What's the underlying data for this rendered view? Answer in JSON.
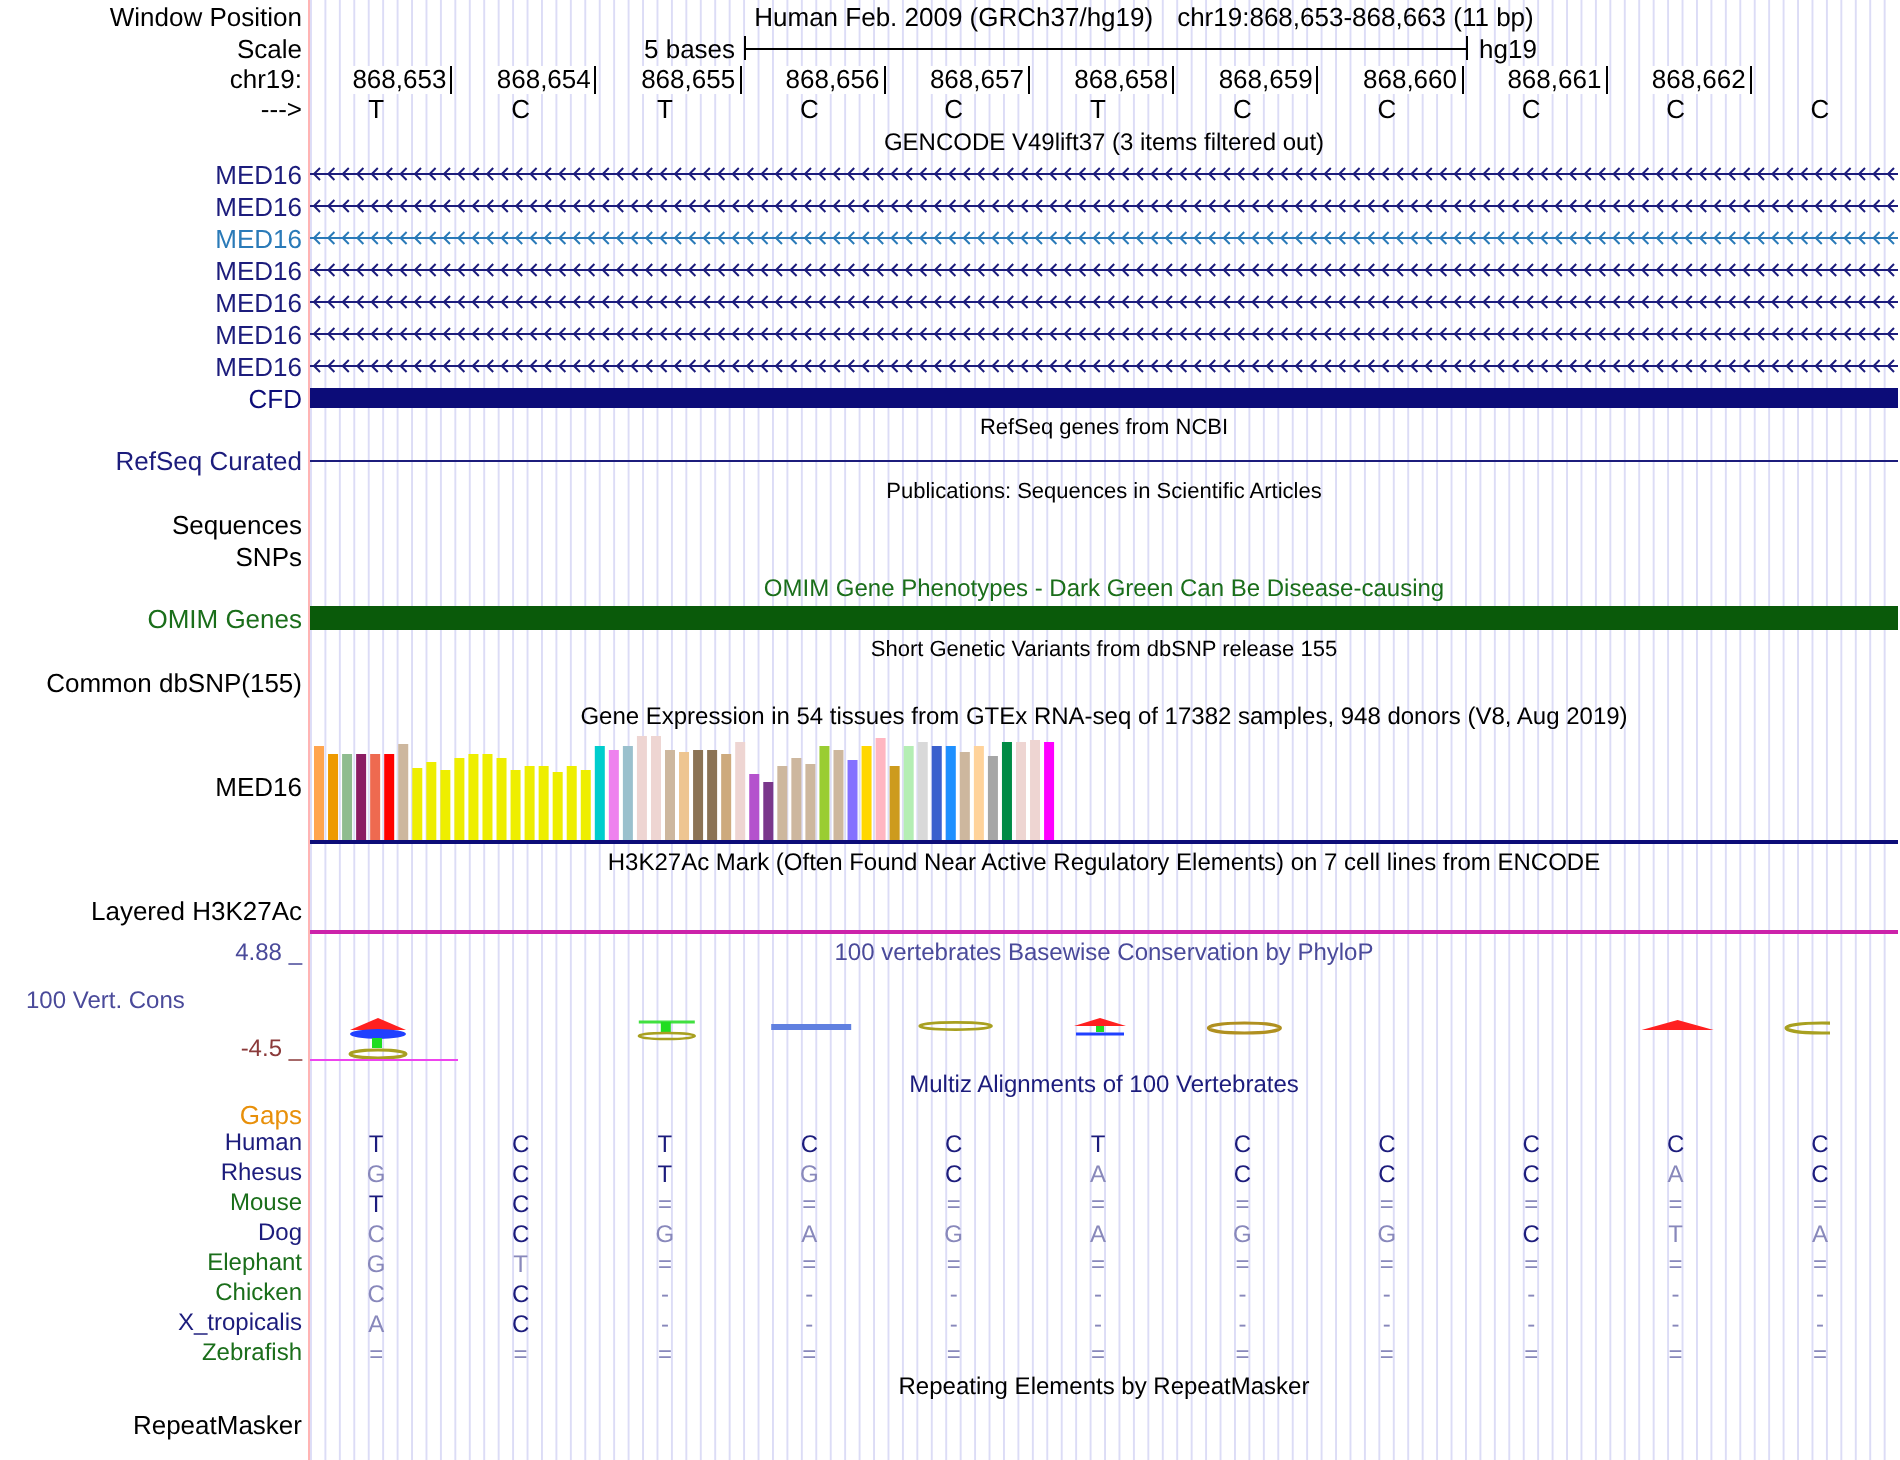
{
  "position_bar": {
    "label": "Window Position",
    "title": "Human Feb. 2009 (GRCh37/hg19)",
    "range": "chr19:868,653-868,663 (11 bp)"
  },
  "scale": {
    "label": "Scale",
    "length": "5 bases",
    "assembly": "hg19"
  },
  "ruler": {
    "label": "chr19:",
    "positions": [
      "868,653",
      "868,654",
      "868,655",
      "868,656",
      "868,657",
      "868,658",
      "868,659",
      "868,660",
      "868,661",
      "868,662"
    ]
  },
  "sequence": {
    "label": "--->",
    "bases": [
      "T",
      "C",
      "T",
      "C",
      "C",
      "T",
      "C",
      "C",
      "C",
      "C",
      "C"
    ]
  },
  "gencode": {
    "title": "GENCODE V49lift37 (3 items filtered out)",
    "genes": [
      {
        "name": "MED16",
        "color": "#1c1c7c"
      },
      {
        "name": "MED16",
        "color": "#1c1c7c"
      },
      {
        "name": "MED16",
        "color": "#2a7ab8"
      },
      {
        "name": "MED16",
        "color": "#1c1c7c"
      },
      {
        "name": "MED16",
        "color": "#1c1c7c"
      },
      {
        "name": "MED16",
        "color": "#1c1c7c"
      },
      {
        "name": "MED16",
        "color": "#1c1c7c"
      }
    ],
    "cfd": {
      "name": "CFD",
      "color": "#0c0c78"
    }
  },
  "refseq": {
    "title": "RefSeq genes from NCBI",
    "label": "RefSeq Curated"
  },
  "publications": {
    "title": "Publications: Sequences in Scientific Articles",
    "labels": [
      "Sequences",
      "SNPs"
    ]
  },
  "omim": {
    "title": "OMIM Gene Phenotypes - Dark Green Can Be Disease-causing",
    "label": "OMIM Genes"
  },
  "dbsnp": {
    "title": "Short Genetic Variants from dbSNP release 155",
    "label": "Common dbSNP(155)"
  },
  "gtex": {
    "title": "Gene Expression in 54 tissues from GTEx RNA-seq of 17382 samples, 948 donors (V8, Aug 2019)",
    "label": "MED16"
  },
  "h3k27ac": {
    "title": "H3K27Ac Mark (Often Found Near Active Regulatory Elements) on 7 cell lines from ENCODE",
    "label": "Layered H3K27Ac"
  },
  "phylop": {
    "title": "100 vertebrates Basewise Conservation by PhyloP",
    "label": "100 Vert. Cons",
    "max": "4.88 _",
    "min": "-4.5 _"
  },
  "multiz": {
    "title": "Multiz Alignments of 100 Vertebrates",
    "gaps_label": "Gaps",
    "species": [
      {
        "name": "Human",
        "color": "#1c1c7c",
        "bases": [
          {
            "text": "T",
            "match": true
          },
          {
            "text": "C",
            "match": true
          },
          {
            "text": "T",
            "match": true
          },
          {
            "text": "C",
            "match": true
          },
          {
            "text": "C",
            "match": true
          },
          {
            "text": "T",
            "match": true
          },
          {
            "text": "C",
            "match": true
          },
          {
            "text": "C",
            "match": true
          },
          {
            "text": "C",
            "match": true
          },
          {
            "text": "C",
            "match": true
          },
          {
            "text": "C",
            "match": true
          }
        ]
      },
      {
        "name": "Rhesus",
        "color": "#1c1c7c",
        "bases": [
          {
            "text": "G",
            "match": false
          },
          {
            "text": "C",
            "match": true
          },
          {
            "text": "T",
            "match": true
          },
          {
            "text": "G",
            "match": false
          },
          {
            "text": "C",
            "match": true
          },
          {
            "text": "A",
            "match": false
          },
          {
            "text": "C",
            "match": true
          },
          {
            "text": "C",
            "match": true
          },
          {
            "text": "C",
            "match": true
          },
          {
            "text": "A",
            "match": false
          },
          {
            "text": "C",
            "match": true
          }
        ]
      },
      {
        "name": "Mouse",
        "color": "#1a6e1a",
        "bases": [
          {
            "text": "T",
            "match": true
          },
          {
            "text": "C",
            "match": true
          },
          {
            "text": "=",
            "match": false
          },
          {
            "text": "=",
            "match": false
          },
          {
            "text": "=",
            "match": false
          },
          {
            "text": "=",
            "match": false
          },
          {
            "text": "=",
            "match": false
          },
          {
            "text": "=",
            "match": false
          },
          {
            "text": "=",
            "match": false
          },
          {
            "text": "=",
            "match": false
          },
          {
            "text": "=",
            "match": false
          }
        ]
      },
      {
        "name": "Dog",
        "color": "#1c1c7c",
        "bases": [
          {
            "text": "C",
            "match": false
          },
          {
            "text": "C",
            "match": true
          },
          {
            "text": "G",
            "match": false
          },
          {
            "text": "A",
            "match": false
          },
          {
            "text": "G",
            "match": false
          },
          {
            "text": "A",
            "match": false
          },
          {
            "text": "G",
            "match": false
          },
          {
            "text": "G",
            "match": false
          },
          {
            "text": "C",
            "match": true
          },
          {
            "text": "T",
            "match": false
          },
          {
            "text": "A",
            "match": false
          }
        ]
      },
      {
        "name": "Elephant",
        "color": "#1a6e1a",
        "bases": [
          {
            "text": "G",
            "match": false
          },
          {
            "text": "T",
            "match": false
          },
          {
            "text": "=",
            "match": false
          },
          {
            "text": "=",
            "match": false
          },
          {
            "text": "=",
            "match": false
          },
          {
            "text": "=",
            "match": false
          },
          {
            "text": "=",
            "match": false
          },
          {
            "text": "=",
            "match": false
          },
          {
            "text": "=",
            "match": false
          },
          {
            "text": "=",
            "match": false
          },
          {
            "text": "=",
            "match": false
          }
        ]
      },
      {
        "name": "Chicken",
        "color": "#1a6e1a",
        "bases": [
          {
            "text": "C",
            "match": false
          },
          {
            "text": "C",
            "match": true
          },
          {
            "text": "-",
            "match": false
          },
          {
            "text": "-",
            "match": false
          },
          {
            "text": "-",
            "match": false
          },
          {
            "text": "-",
            "match": false
          },
          {
            "text": "-",
            "match": false
          },
          {
            "text": "-",
            "match": false
          },
          {
            "text": "-",
            "match": false
          },
          {
            "text": "-",
            "match": false
          },
          {
            "text": "-",
            "match": false
          }
        ]
      },
      {
        "name": "X_tropicalis",
        "color": "#1c1c7c",
        "bases": [
          {
            "text": "A",
            "match": false
          },
          {
            "text": "C",
            "match": true
          },
          {
            "text": "-",
            "match": false
          },
          {
            "text": "-",
            "match": false
          },
          {
            "text": "-",
            "match": false
          },
          {
            "text": "-",
            "match": false
          },
          {
            "text": "-",
            "match": false
          },
          {
            "text": "-",
            "match": false
          },
          {
            "text": "-",
            "match": false
          },
          {
            "text": "-",
            "match": false
          },
          {
            "text": "-",
            "match": false
          }
        ]
      },
      {
        "name": "Zebrafish",
        "color": "#1a6e1a",
        "bases": [
          {
            "text": "=",
            "match": false
          },
          {
            "text": "=",
            "match": false
          },
          {
            "text": "=",
            "match": false
          },
          {
            "text": "=",
            "match": false
          },
          {
            "text": "=",
            "match": false
          },
          {
            "text": "=",
            "match": false
          },
          {
            "text": "=",
            "match": false
          },
          {
            "text": "=",
            "match": false
          },
          {
            "text": "=",
            "match": false
          },
          {
            "text": "=",
            "match": false
          },
          {
            "text": "=",
            "match": false
          }
        ]
      }
    ]
  },
  "repeatmasker": {
    "title": "Repeating Elements by RepeatMasker",
    "label": "RepeatMasker"
  }
}
